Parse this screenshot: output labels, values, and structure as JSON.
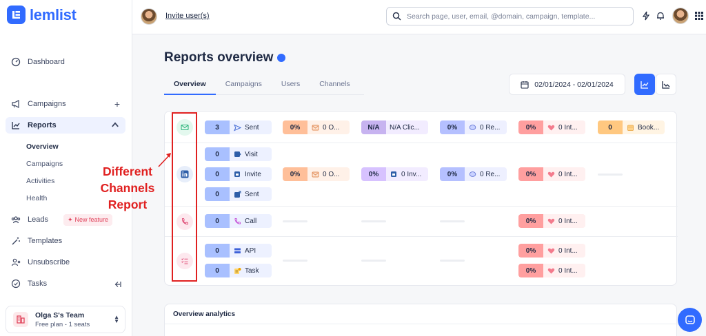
{
  "brand": {
    "name": "lemlist"
  },
  "sidebar": {
    "items": [
      {
        "label": "Dashboard"
      },
      {
        "label": "Campaigns"
      },
      {
        "label": "Reports"
      },
      {
        "label": "Leads",
        "badge": "New feature"
      },
      {
        "label": "Templates"
      },
      {
        "label": "Unsubscribe"
      },
      {
        "label": "Tasks"
      }
    ],
    "reports_sub": [
      "Overview",
      "Campaigns",
      "Activities",
      "Health"
    ],
    "team": {
      "name": "Olga S's Team",
      "plan": "Free plan - 1 seats"
    }
  },
  "topbar": {
    "invite_label": "Invite user(s)",
    "search_placeholder": "Search page, user, email, @domain, campaign, template..."
  },
  "main": {
    "title": "Reports overview",
    "tabs": [
      "Overview",
      "Campaigns",
      "Users",
      "Channels"
    ],
    "date_range": "02/01/2024 - 02/01/2024"
  },
  "report_rows": {
    "email": {
      "sent": {
        "value": "3",
        "label": "Sent"
      },
      "opened": {
        "value": "0%",
        "label": "0 O..."
      },
      "clicked": {
        "value": "N/A",
        "label": "N/A Clic..."
      },
      "replied": {
        "value": "0%",
        "label": "0 Re..."
      },
      "interested": {
        "value": "0%",
        "label": "0 Int..."
      },
      "booked": {
        "value": "0",
        "label": "Book..."
      }
    },
    "linkedin": {
      "visit": {
        "value": "0",
        "label": "Visit"
      },
      "invite": {
        "value": "0",
        "label": "Invite"
      },
      "sent": {
        "value": "0",
        "label": "Sent"
      },
      "opened": {
        "value": "0%",
        "label": "0 O..."
      },
      "invite_accepted": {
        "value": "0%",
        "label": "0 Inv..."
      },
      "replied": {
        "value": "0%",
        "label": "0 Re..."
      },
      "interested": {
        "value": "0%",
        "label": "0 Int..."
      }
    },
    "call": {
      "call": {
        "value": "0",
        "label": "Call"
      },
      "interested": {
        "value": "0%",
        "label": "0 Int..."
      }
    },
    "tasks": {
      "api": {
        "value": "0",
        "label": "API"
      },
      "task": {
        "value": "0",
        "label": "Task"
      },
      "interested_api": {
        "value": "0%",
        "label": "0 Int..."
      },
      "interested_task": {
        "value": "0%",
        "label": "0 Int..."
      }
    }
  },
  "annotation": {
    "text": "Different Channels Report"
  },
  "analytics": {
    "title": "Overview analytics"
  },
  "colors": {
    "accent": "#316bff",
    "sent": "#a9c0ff",
    "opened": "#ffbf99",
    "clicked": "#d7c2ff",
    "replied": "#b5c0ff",
    "interested": "#ff9f9f",
    "booked": "#ffc880",
    "annotation": "#e02020"
  }
}
